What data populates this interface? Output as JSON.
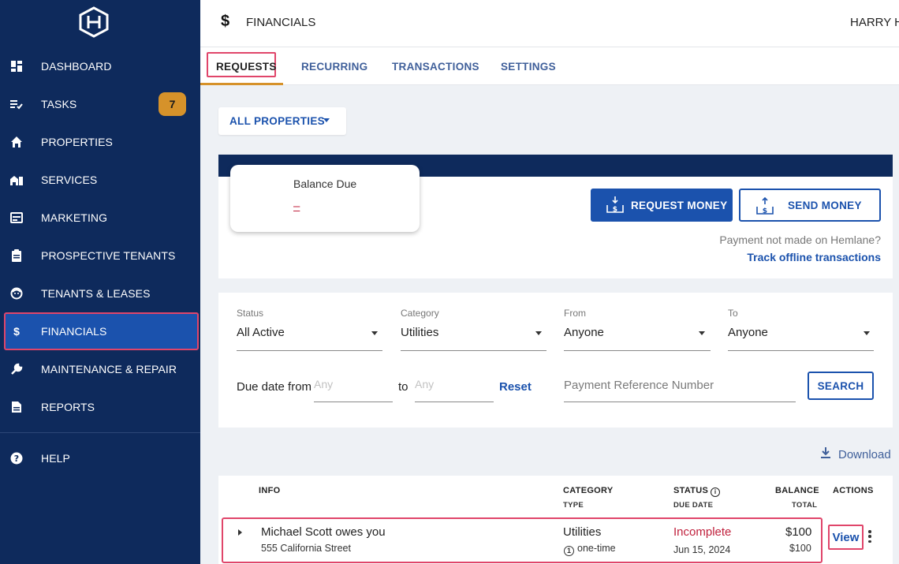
{
  "sidebar": {
    "logo": "hemlane-logo",
    "items": [
      {
        "label": "DASHBOARD",
        "icon": "dashboard-icon"
      },
      {
        "label": "TASKS",
        "icon": "tasks-icon",
        "badge": "7"
      },
      {
        "label": "PROPERTIES",
        "icon": "home-icon"
      },
      {
        "label": "SERVICES",
        "icon": "services-icon"
      },
      {
        "label": "MARKETING",
        "icon": "marketing-icon"
      },
      {
        "label": "PROSPECTIVE TENANTS",
        "icon": "clipboard-icon"
      },
      {
        "label": "TENANTS & LEASES",
        "icon": "tenant-face-icon"
      },
      {
        "label": "FINANCIALS",
        "icon": "dollar-icon",
        "active": true
      },
      {
        "label": "MAINTENANCE & REPAIR",
        "icon": "wrench-icon"
      },
      {
        "label": "REPORTS",
        "icon": "document-icon"
      },
      {
        "label": "HELP",
        "icon": "help-icon"
      }
    ]
  },
  "header": {
    "icon": "$",
    "title": "FINANCIALS",
    "user": "HARRY HO"
  },
  "tabs": [
    {
      "label": "REQUESTS",
      "selected": true
    },
    {
      "label": "RECURRING"
    },
    {
      "label": "TRANSACTIONS"
    },
    {
      "label": "SETTINGS"
    }
  ],
  "property_filter": {
    "label": "ALL PROPERTIES"
  },
  "balance": {
    "title": "Balance Due",
    "value": "–",
    "request_money": "REQUEST MONEY",
    "send_money": "SEND MONEY",
    "offline_question": "Payment not made on Hemlane?",
    "offline_link": "Track offline transactions"
  },
  "filters": {
    "status": {
      "label": "Status",
      "value": "All Active"
    },
    "category": {
      "label": "Category",
      "value": "Utilities"
    },
    "from": {
      "label": "From",
      "value": "Anyone"
    },
    "to": {
      "label": "To",
      "value": "Anyone"
    },
    "due_date_label": "Due date from",
    "due_from_placeholder": "Any",
    "to_label": "to",
    "due_to_placeholder": "Any",
    "reset": "Reset",
    "payment_ref_placeholder": "Payment Reference Number",
    "search": "SEARCH"
  },
  "download": "Download",
  "table": {
    "headers": {
      "info": "INFO",
      "category": "CATEGORY",
      "category_sub": "TYPE",
      "status": "STATUS",
      "status_sub": "DUE DATE",
      "balance": "BALANCE",
      "balance_sub": "TOTAL",
      "actions": "ACTIONS"
    },
    "rows": [
      {
        "title": "Michael Scott owes you",
        "address": "555 California Street",
        "category": "Utilities",
        "type": "one-time",
        "status": "Incomplete",
        "due_date": "Jun 15, 2024",
        "balance": "$100",
        "total": "$100",
        "action": "View"
      }
    ]
  },
  "colors": {
    "sidebar_bg": "#0e2a5c",
    "primary": "#1b52ad",
    "accent": "#d6922a",
    "highlight": "#e0456a",
    "error": "#c0213d"
  }
}
